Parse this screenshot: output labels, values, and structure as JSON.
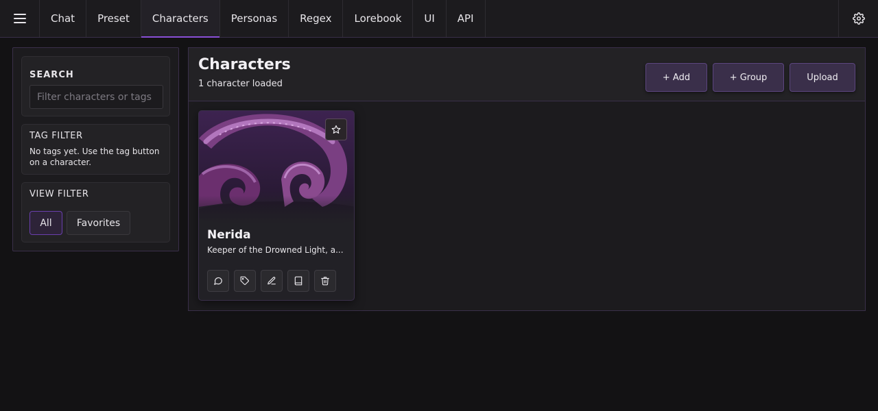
{
  "nav": {
    "menu_icon": "hamburger-icon",
    "tabs": [
      {
        "label": "Chat"
      },
      {
        "label": "Preset"
      },
      {
        "label": "Characters",
        "active": true
      },
      {
        "label": "Personas"
      },
      {
        "label": "Regex"
      },
      {
        "label": "Lorebook"
      },
      {
        "label": "UI"
      },
      {
        "label": "API"
      }
    ],
    "settings_icon": "gear-icon"
  },
  "sidebar": {
    "search": {
      "label": "SEARCH",
      "placeholder": "Filter characters or tags",
      "value": ""
    },
    "tag_filter": {
      "label": "TAG FILTER",
      "note": "No tags yet. Use the tag button on a character."
    },
    "view_filter": {
      "label": "VIEW FILTER",
      "options": [
        "All",
        "Favorites"
      ],
      "selected": "All"
    }
  },
  "main": {
    "title": "Characters",
    "subtitle": "1 character loaded",
    "buttons": {
      "add": "+ Add",
      "group": "+ Group",
      "upload": "Upload"
    },
    "characters": [
      {
        "name": "Nerida",
        "description": "Keeper of the Drowned Light, a...",
        "favorite_icon": "star-icon",
        "actions": [
          "chat-icon",
          "tag-icon",
          "edit-icon",
          "book-icon",
          "trash-icon"
        ]
      }
    ]
  },
  "colors": {
    "accent": "#8a4fd8",
    "button_bg": "#3a2f4a",
    "background": "#131214"
  }
}
